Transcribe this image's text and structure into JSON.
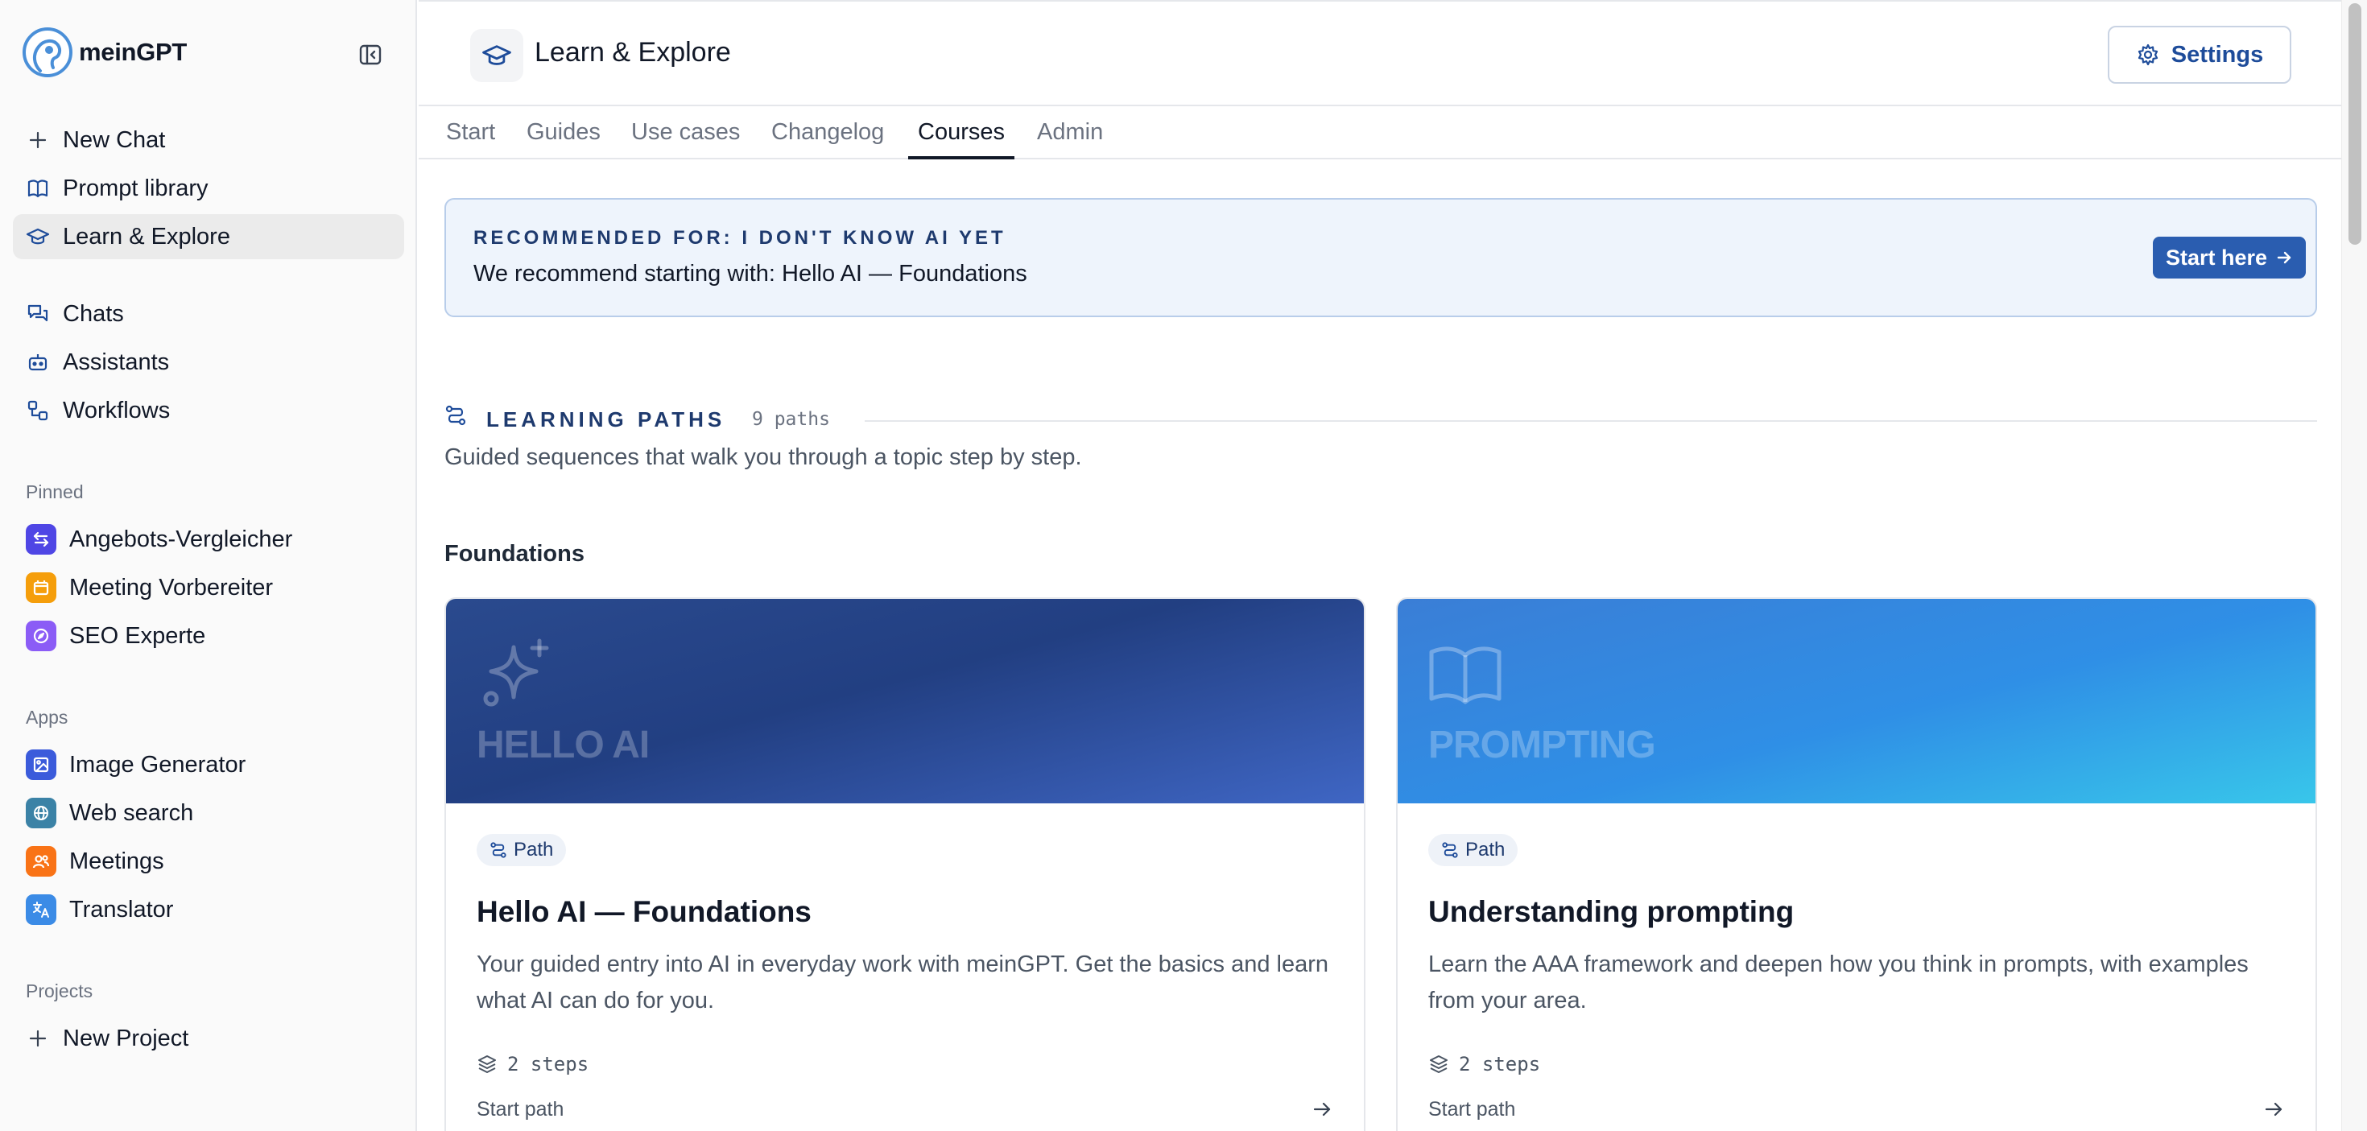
{
  "brand": {
    "name": "meinGPT"
  },
  "sidebar": {
    "nav": [
      {
        "label": "New Chat",
        "icon": "plus-icon"
      },
      {
        "label": "Prompt library",
        "icon": "book-icon"
      },
      {
        "label": "Learn & Explore",
        "icon": "graduation-cap-icon",
        "active": true
      }
    ],
    "nav2": [
      {
        "label": "Chats",
        "icon": "chats-icon"
      },
      {
        "label": "Assistants",
        "icon": "bot-icon"
      },
      {
        "label": "Workflows",
        "icon": "workflow-icon"
      }
    ],
    "pinned_label": "Pinned",
    "pinned": [
      {
        "label": "Angebots-Vergleicher",
        "color": "#4f46e5"
      },
      {
        "label": "Meeting Vorbereiter",
        "color": "#f59e0b"
      },
      {
        "label": "SEO Experte",
        "color": "#8b5cf6"
      }
    ],
    "apps_label": "Apps",
    "apps": [
      {
        "label": "Image Generator",
        "color": "#3b5bdb"
      },
      {
        "label": "Web search",
        "color": "#3b82a6"
      },
      {
        "label": "Meetings",
        "color": "#f97316"
      },
      {
        "label": "Translator",
        "color": "#3b8be6"
      }
    ],
    "projects_label": "Projects",
    "new_project": "New Project"
  },
  "header": {
    "title": "Learn & Explore",
    "settings_label": "Settings"
  },
  "tabs": [
    {
      "label": "Start"
    },
    {
      "label": "Guides"
    },
    {
      "label": "Use cases"
    },
    {
      "label": "Changelog"
    },
    {
      "label": "Courses",
      "active": true
    },
    {
      "label": "Admin"
    }
  ],
  "recommendation": {
    "label": "RECOMMENDED FOR: I DON'T KNOW AI YET",
    "text": "We recommend starting with: Hello AI — Foundations",
    "button": "Start here"
  },
  "learning_paths": {
    "title": "LEARNING PATHS",
    "count": "9 paths",
    "description": "Guided sequences that walk you through a topic step by step.",
    "group": "Foundations",
    "cards": [
      {
        "hero_word": "HELLO AI",
        "badge": "Path",
        "title": "Hello AI — Foundations",
        "description": "Your guided entry into AI in everyday work with meinGPT. Get the basics and learn what AI can do for you.",
        "steps": "2 steps",
        "cta": "Start path"
      },
      {
        "hero_word": "PROMPTING",
        "badge": "Path",
        "title": "Understanding prompting",
        "description": "Learn the AAA framework and deepen how you think in prompts, with examples from your area.",
        "steps": "2 steps",
        "cta": "Start path"
      }
    ]
  },
  "colors": {
    "accent": "#2a5db0",
    "heading_navy": "#1e3a6e"
  }
}
